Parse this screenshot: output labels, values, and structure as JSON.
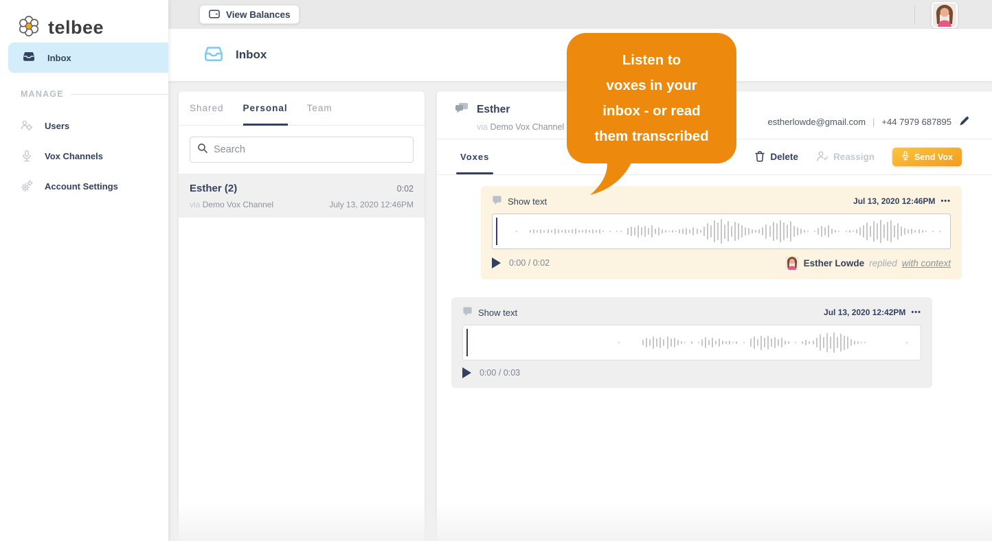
{
  "brand": {
    "name": "telbee"
  },
  "topbar": {
    "view_balances_label": "View Balances"
  },
  "sidebar": {
    "inbox_label": "Inbox",
    "manage_label": "MANAGE",
    "items": [
      {
        "label": "Users"
      },
      {
        "label": "Vox Channels"
      },
      {
        "label": "Account Settings"
      }
    ]
  },
  "header": {
    "title": "Inbox"
  },
  "conversation_list": {
    "tabs": [
      {
        "label": "Shared",
        "active": false
      },
      {
        "label": "Personal",
        "active": true
      },
      {
        "label": "Team",
        "active": false
      }
    ],
    "search_placeholder": "Search",
    "items": [
      {
        "name": "Esther (2)",
        "duration": "0:02",
        "via_label": "via",
        "channel": "Demo Vox Channel",
        "timestamp": "July 13, 2020 12:46PM"
      }
    ]
  },
  "thread": {
    "contact_name": "Esther",
    "via_label": "via",
    "channel": "Demo Vox Channel",
    "email": "estherlowde@gmail.com",
    "separator": "|",
    "phone": "+44 7979 687895",
    "tab_label": "Voxes",
    "actions": {
      "delete_label": "Delete",
      "reassign_label": "Reassign",
      "send_vox_label": "Send Vox"
    },
    "messages": [
      {
        "show_text_label": "Show text",
        "timestamp": "Jul 13, 2020 12:46PM",
        "menu_glyph": "•••",
        "elapsed": "0:00",
        "time_sep": "/",
        "duration": "0:02",
        "reply_name": "Esther Lowde",
        "reply_action": "replied",
        "reply_link": "with context",
        "waveform": [
          0,
          0,
          4,
          0,
          0,
          0,
          8,
          12,
          10,
          14,
          9,
          16,
          11,
          18,
          13,
          10,
          15,
          9,
          12,
          17,
          10,
          8,
          13,
          11,
          16,
          9,
          12,
          7,
          0,
          4,
          0,
          4,
          5,
          0,
          22,
          35,
          28,
          45,
          30,
          38,
          25,
          42,
          20,
          30,
          15,
          8,
          5,
          10,
          6,
          12,
          18,
          25,
          15,
          30,
          20,
          10,
          35,
          55,
          45,
          75,
          60,
          85,
          50,
          70,
          40,
          65,
          55,
          45,
          30,
          25,
          12,
          8,
          15,
          30,
          50,
          40,
          68,
          55,
          78,
          62,
          48,
          70,
          38,
          28,
          18,
          10,
          6,
          0,
          5,
          25,
          40,
          30,
          45,
          20,
          8,
          5,
          0,
          4,
          10,
          6,
          12,
          28,
          45,
          60,
          38,
          72,
          55,
          80,
          48,
          65,
          75,
          42,
          58,
          35,
          25,
          15,
          20,
          10,
          12,
          8,
          5,
          0,
          4,
          0,
          3
        ]
      },
      {
        "show_text_label": "Show text",
        "timestamp": "Jul 13, 2020 12:42PM",
        "menu_glyph": "•••",
        "elapsed": "0:00",
        "time_sep": "/",
        "duration": "0:03",
        "waveform": [
          0,
          0,
          0,
          0,
          0,
          0,
          0,
          0,
          0,
          0,
          0,
          0,
          0,
          0,
          0,
          0,
          0,
          0,
          0,
          0,
          0,
          0,
          0,
          0,
          0,
          0,
          0,
          0,
          0,
          0,
          0,
          0,
          0,
          0,
          0,
          0,
          0,
          0,
          0,
          0,
          4,
          0,
          0,
          0,
          0,
          0,
          0,
          20,
          35,
          25,
          42,
          30,
          38,
          22,
          45,
          28,
          35,
          18,
          10,
          6,
          0,
          8,
          0,
          5,
          25,
          40,
          20,
          35,
          15,
          28,
          12,
          8,
          14,
          6,
          10,
          0,
          5,
          0,
          30,
          45,
          25,
          50,
          35,
          48,
          28,
          40,
          22,
          32,
          15,
          8,
          0,
          6,
          0,
          10,
          18,
          8,
          12,
          35,
          55,
          40,
          65,
          45,
          70,
          38,
          60,
          50,
          42,
          25,
          15,
          8,
          5,
          3,
          0,
          0,
          0,
          0,
          0,
          0,
          0,
          0,
          0,
          0,
          0,
          4,
          0
        ]
      }
    ]
  },
  "tooltip": {
    "lines": [
      "Listen to",
      "voxes in your",
      "inbox - or read",
      "them transcribed"
    ]
  },
  "colors": {
    "accent_orange": "#ed8a0d",
    "send_vox_gradient_start": "#fcc53e",
    "send_vox_gradient_end": "#f29c1c",
    "inbox_highlight_blue": "#d3edfa",
    "header_icon_blue": "#7ec9ee",
    "navy_text": "#33415e",
    "card_highlight_bg": "#fcf3e1",
    "card_plain_bg": "#efefef",
    "logo_center": "#f2a918"
  }
}
